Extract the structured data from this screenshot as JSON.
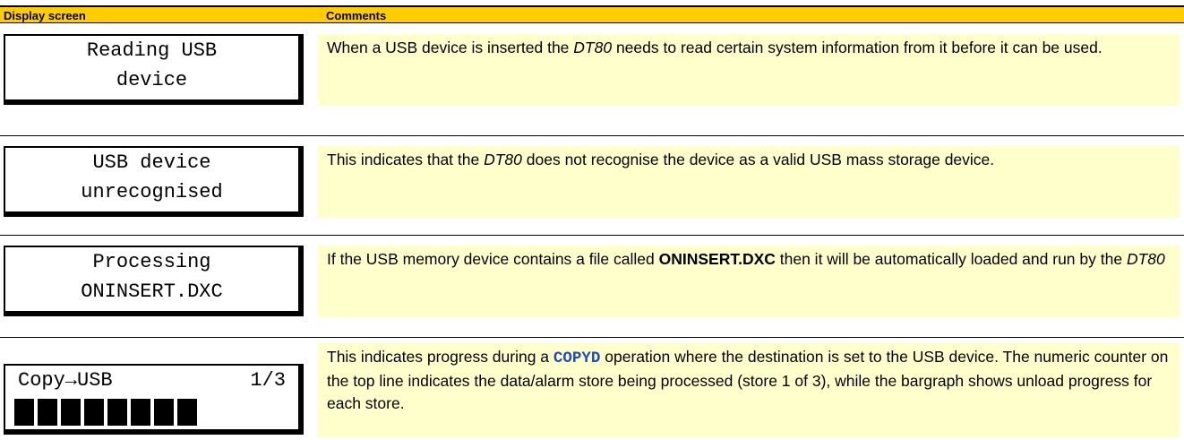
{
  "header": {
    "display_screen": "Display screen",
    "comments": "Comments"
  },
  "rows": [
    {
      "lcd_line1": "Reading USB",
      "lcd_line2": "device",
      "comment": {
        "part1": "When a USB device is inserted the ",
        "dt80": "DT80",
        "part2": " needs to read certain system information from it before it can be used."
      }
    },
    {
      "lcd_line1": "USB device",
      "lcd_line2": "unrecognised",
      "comment": {
        "part1": "This indicates that the ",
        "dt80": "DT80",
        "part2": " does not recognise the device as a valid USB mass storage device."
      }
    },
    {
      "lcd_line1": "Processing",
      "lcd_line2": "ONINSERT.DXC",
      "comment": {
        "part1": "If the USB memory device contains a file called ",
        "filename": "ONINSERT.DXC",
        "part2": " then it will be automatically loaded and run by the ",
        "dt80": "DT80"
      }
    },
    {
      "lcd_copy": "Copy→USB",
      "lcd_count": "1/3",
      "bargraph_segments": 8,
      "comment": {
        "part1": "This indicates progress during a ",
        "command": "COPYD",
        "part2": " operation where the destination is set to the USB device. The numeric counter on the top line indicates the data/alarm store being processed (store 1 of 3), while the bargraph shows unload progress for each store."
      }
    }
  ],
  "colors": {
    "header_bg": "#ffcc00",
    "comment_bg": "#ffffcc",
    "command_text": "#1f4fb5"
  }
}
